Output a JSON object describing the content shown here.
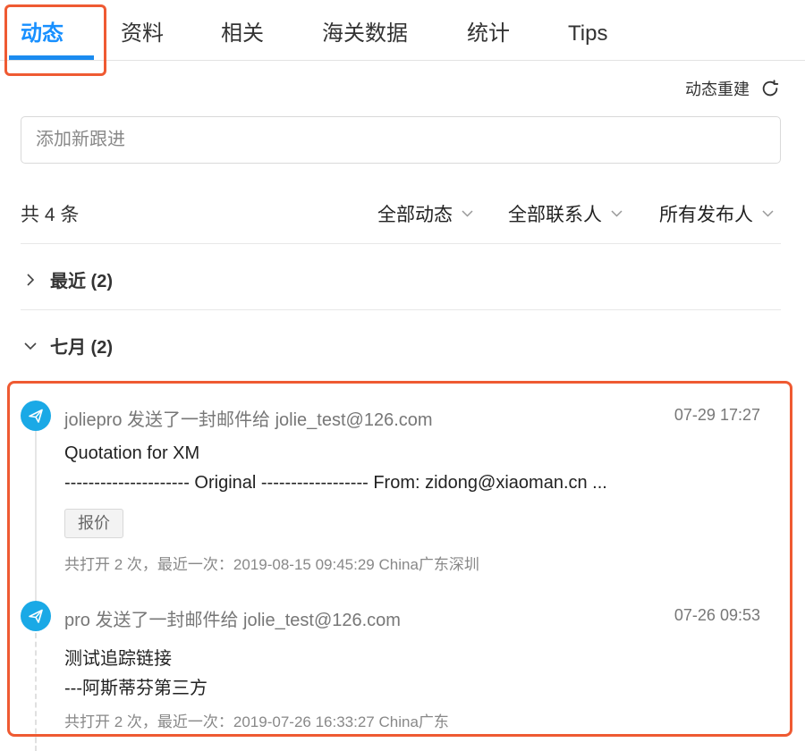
{
  "tabs": [
    {
      "label": "动态",
      "active": true
    },
    {
      "label": "资料"
    },
    {
      "label": "相关"
    },
    {
      "label": "海关数据"
    },
    {
      "label": "统计"
    },
    {
      "label": "Tips"
    }
  ],
  "rebuild": {
    "label": "动态重建",
    "icon": "refresh-icon"
  },
  "new_follow": {
    "placeholder": "添加新跟进",
    "value": ""
  },
  "summary": {
    "count_label": "共 4 条"
  },
  "filters": [
    {
      "label": "全部动态"
    },
    {
      "label": "全部联系人"
    },
    {
      "label": "所有发布人"
    }
  ],
  "groups": [
    {
      "label": "最近 (2)",
      "expanded": false
    },
    {
      "label": "七月 (2)",
      "expanded": true
    }
  ],
  "items": [
    {
      "icon": "paper-plane-icon",
      "header": "joliepro 发送了一封邮件给 jolie_test@126.com",
      "time": "07-29 17:27",
      "line1": "Quotation for XM",
      "line2": "--------------------- Original ------------------ From: zidong@xiaoman.cn ...",
      "tag": "报价",
      "meta": "共打开 2 次，最近一次：2019-08-15 09:45:29 China广东深圳"
    },
    {
      "icon": "paper-plane-icon",
      "header": "pro 发送了一封邮件给 jolie_test@126.com",
      "time": "07-26 09:53",
      "line1": "测试追踪链接",
      "line2": "---阿斯蒂芬第三方",
      "meta": "共打开 2 次，最近一次：2019-07-26 16:33:27 China广东"
    }
  ],
  "colors": {
    "accent": "#1890ff",
    "highlight": "#ef5a32",
    "avatar": "#1aa9e6"
  }
}
